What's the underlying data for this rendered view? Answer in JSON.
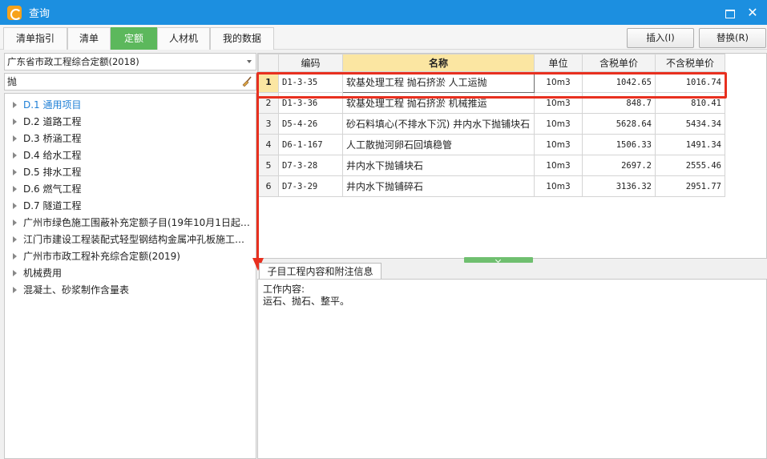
{
  "window": {
    "title": "查询"
  },
  "tabs": [
    {
      "label": "清单指引"
    },
    {
      "label": "清单"
    },
    {
      "label": "定额",
      "active": true
    },
    {
      "label": "人材机"
    },
    {
      "label": "我的数据"
    }
  ],
  "actions": {
    "insert": "插入(I)",
    "replace": "替换(R)"
  },
  "left": {
    "library": "广东省市政工程综合定额(2018)",
    "search": "抛",
    "tree": [
      {
        "label": "D.1 通用项目",
        "selected": true
      },
      {
        "label": "D.2 道路工程"
      },
      {
        "label": "D.3 桥涵工程"
      },
      {
        "label": "D.4 给水工程"
      },
      {
        "label": "D.5 排水工程"
      },
      {
        "label": "D.6 燃气工程"
      },
      {
        "label": "D.7 隧道工程"
      },
      {
        "label": "广州市绿色施工围蔽补充定额子目(19年10月1日起…"
      },
      {
        "label": "江门市建设工程装配式轻型钢结构金属冲孔板施工…"
      },
      {
        "label": "广州市市政工程补充综合定额(2019)"
      },
      {
        "label": "机械费用"
      },
      {
        "label": "混凝土、砂浆制作含量表"
      }
    ]
  },
  "grid": {
    "headers": {
      "code": "编码",
      "name": "名称",
      "unit": "单位",
      "price_tax": "含税单价",
      "price_notax": "不含税单价"
    },
    "rows": [
      {
        "no": "1",
        "code": "D1-3-35",
        "name": "软基处理工程 抛石挤淤 人工运抛",
        "unit": "10m3",
        "price_tax": "1042.65",
        "price_notax": "1016.74"
      },
      {
        "no": "2",
        "code": "D1-3-36",
        "name": "软基处理工程 抛石挤淤 机械推运",
        "unit": "10m3",
        "price_tax": "848.7",
        "price_notax": "810.41"
      },
      {
        "no": "3",
        "code": "D5-4-26",
        "name": "砂石料填心(不排水下沉) 井内水下抛铺块石",
        "unit": "10m3",
        "price_tax": "5628.64",
        "price_notax": "5434.34"
      },
      {
        "no": "4",
        "code": "D6-1-167",
        "name": "人工散抛河卵石回填稳管",
        "unit": "10m3",
        "price_tax": "1506.33",
        "price_notax": "1491.34"
      },
      {
        "no": "5",
        "code": "D7-3-28",
        "name": "井内水下抛铺块石",
        "unit": "10m3",
        "price_tax": "2697.2",
        "price_notax": "2555.46"
      },
      {
        "no": "6",
        "code": "D7-3-29",
        "name": "井内水下抛铺碎石",
        "unit": "10m3",
        "price_tax": "3136.32",
        "price_notax": "2951.77"
      }
    ]
  },
  "info": {
    "tab": "子目工程内容和附注信息",
    "heading": "工作内容:",
    "content": "运石、抛石、整平。"
  },
  "colors": {
    "titlebar": "#1c8fe0",
    "active_tab": "#5cb85c",
    "highlight": "#e8301f",
    "selected_header": "#fbe6a2"
  },
  "icons": {
    "app": "app-logo-icon",
    "clear_search": "broom-icon"
  }
}
